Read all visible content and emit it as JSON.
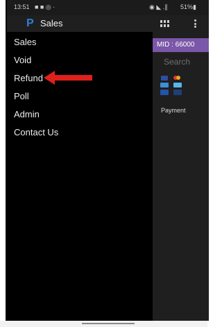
{
  "status_bar": {
    "time": "13:51",
    "left_icons": "■ ■ ◎ ·",
    "right_icons": "◉ ◣ .∥",
    "battery": "51%▮"
  },
  "header": {
    "title": "Sales",
    "logo": "P"
  },
  "menu": {
    "items": [
      {
        "label": "Sales"
      },
      {
        "label": "Void"
      },
      {
        "label": "Refund"
      },
      {
        "label": "Poll"
      },
      {
        "label": "Admin"
      },
      {
        "label": "Contact Us"
      }
    ]
  },
  "right_pane": {
    "mid_label": "MID : 66000",
    "search_label": "Search",
    "payment_label": "Payment"
  },
  "colors": {
    "accent_purple": "#7a57a8",
    "logo_blue": "#2f7dd8",
    "arrow_red": "#e0201b"
  }
}
